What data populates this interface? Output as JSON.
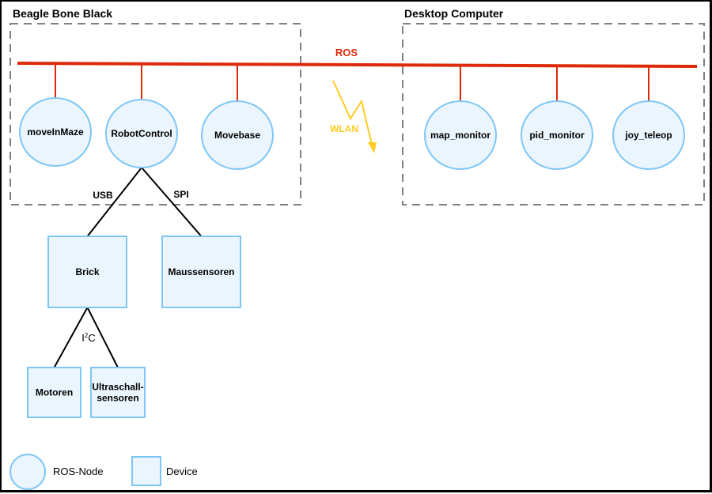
{
  "groups": {
    "bbb": {
      "label": "Beagle Bone Black"
    },
    "desktop": {
      "label": "Desktop Computer"
    }
  },
  "bus": {
    "label": "ROS",
    "color": "#dd2a0a"
  },
  "wireless": {
    "label": "WLAN",
    "color": "#ffcc22"
  },
  "ros_nodes": [
    {
      "id": "moveInMaze",
      "label": "moveInMaze",
      "group": "bbb"
    },
    {
      "id": "RobotControl",
      "label": "RobotControl",
      "group": "bbb"
    },
    {
      "id": "Movebase",
      "label": "Movebase",
      "group": "bbb"
    },
    {
      "id": "map_monitor",
      "label": "map_monitor",
      "group": "desktop"
    },
    {
      "id": "pid_monitor",
      "label": "pid_monitor",
      "group": "desktop"
    },
    {
      "id": "joy_teleop",
      "label": "joy_teleop",
      "group": "desktop"
    }
  ],
  "devices": [
    {
      "id": "Brick",
      "label": [
        "Brick"
      ]
    },
    {
      "id": "Maussensoren",
      "label": [
        "Maussensoren"
      ]
    },
    {
      "id": "Motoren",
      "label": [
        "Motoren"
      ]
    },
    {
      "id": "Ultraschallsensoren",
      "label": [
        "Ultraschall-",
        "sensoren"
      ]
    }
  ],
  "links": [
    {
      "from": "RobotControl",
      "to": "Brick",
      "label": "USB"
    },
    {
      "from": "RobotControl",
      "to": "Maussensoren",
      "label": "SPI"
    },
    {
      "from": "Brick",
      "to": "Motoren",
      "label": "I2C",
      "label_main": "I",
      "label_sup": "2",
      "label_tail": "C"
    },
    {
      "from": "Brick",
      "to": "Ultraschallsensoren",
      "label": ""
    }
  ],
  "legend": {
    "ros_node": "ROS-Node",
    "device": "Device"
  },
  "colors": {
    "node_fill": "#eaf5fd",
    "node_stroke": "#7fc6f5",
    "group_stroke": "#808080",
    "link_color": "#000000"
  }
}
